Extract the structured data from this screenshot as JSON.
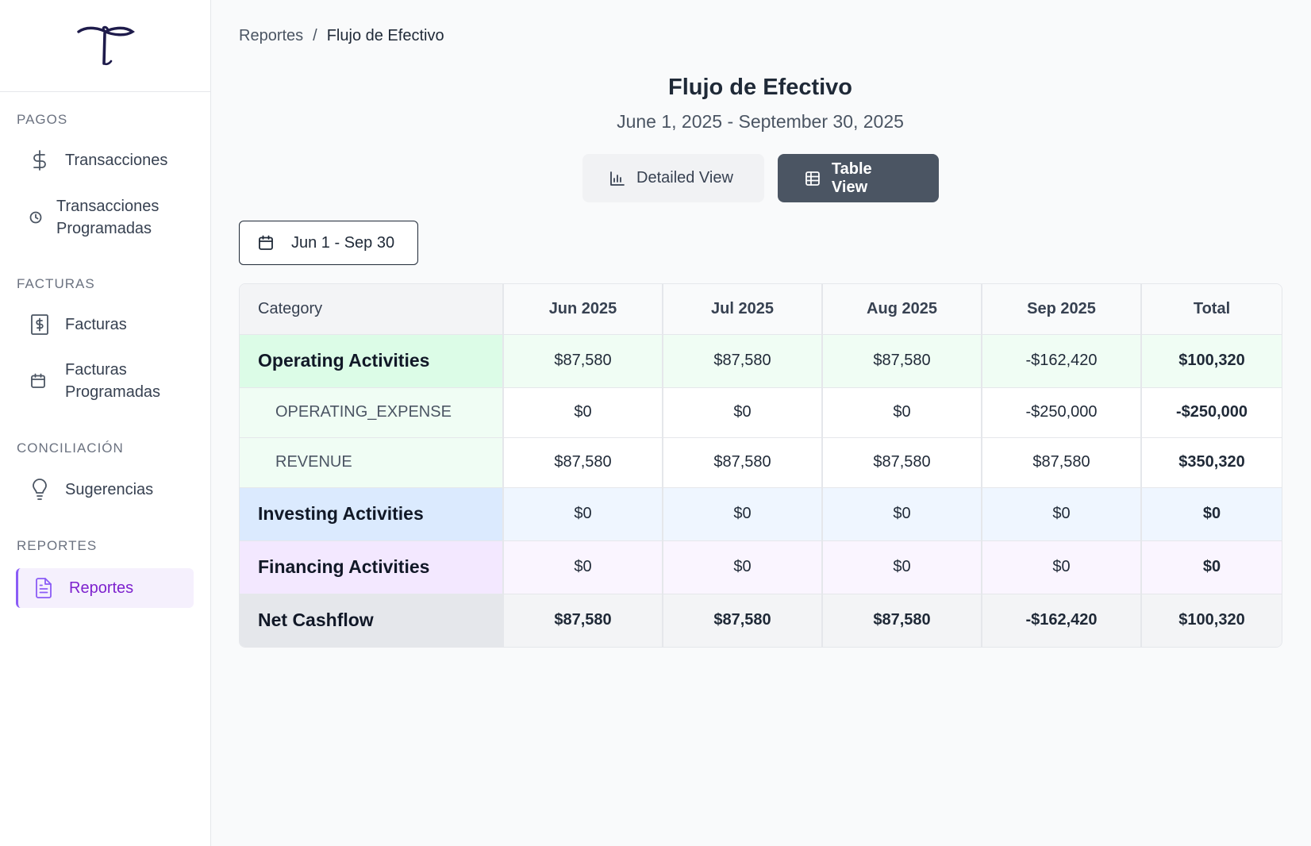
{
  "sidebar": {
    "sections": [
      {
        "label": "PAGOS",
        "items": [
          {
            "label": "Transacciones",
            "icon": "dollar-icon"
          },
          {
            "label": "Transacciones Programadas",
            "icon": "clock-icon"
          }
        ]
      },
      {
        "label": "FACTURAS",
        "items": [
          {
            "label": "Facturas",
            "icon": "receipt-icon"
          },
          {
            "label": "Facturas Programadas",
            "icon": "calendar-icon"
          }
        ]
      },
      {
        "label": "CONCILIACIÓN",
        "items": [
          {
            "label": "Sugerencias",
            "icon": "lightbulb-icon"
          }
        ]
      },
      {
        "label": "REPORTES",
        "items": [
          {
            "label": "Reportes",
            "icon": "file-text-icon",
            "active": true
          }
        ]
      }
    ]
  },
  "breadcrumb": {
    "parent": "Reportes",
    "separator": "/",
    "current": "Flujo de Efectivo"
  },
  "header": {
    "title": "Flujo de Efectivo",
    "subtitle": "June 1, 2025 - September 30, 2025"
  },
  "view_toggle": {
    "detailed": "Detailed View",
    "table": "Table View",
    "selected": "Table View"
  },
  "date_range": {
    "label": "Jun 1 - Sep 30"
  },
  "table": {
    "columns": [
      "Category",
      "Jun 2025",
      "Jul 2025",
      "Aug 2025",
      "Sep 2025",
      "Total"
    ],
    "rows": [
      {
        "category": "Operating Activities",
        "values": [
          "$87,580",
          "$87,580",
          "$87,580",
          "-$162,420"
        ],
        "total": "$100,320"
      },
      {
        "category": "OPERATING_EXPENSE",
        "values": [
          "$0",
          "$0",
          "$0",
          "-$250,000"
        ],
        "total": "-$250,000"
      },
      {
        "category": "REVENUE",
        "values": [
          "$87,580",
          "$87,580",
          "$87,580",
          "$87,580"
        ],
        "total": "$350,320"
      },
      {
        "category": "Investing Activities",
        "values": [
          "$0",
          "$0",
          "$0",
          "$0"
        ],
        "total": "$0"
      },
      {
        "category": "Financing Activities",
        "values": [
          "$0",
          "$0",
          "$0",
          "$0"
        ],
        "total": "$0"
      },
      {
        "category": "Net Cashflow",
        "values": [
          "$87,580",
          "$87,580",
          "$87,580",
          "-$162,420"
        ],
        "total": "$100,320"
      }
    ]
  },
  "colors": {
    "accent": "#8b5cf6",
    "operating": "#dcfce7",
    "investing": "#dbeafe",
    "financing": "#f3e8ff",
    "net": "#e5e7eb",
    "active_button": "#4b5563"
  }
}
